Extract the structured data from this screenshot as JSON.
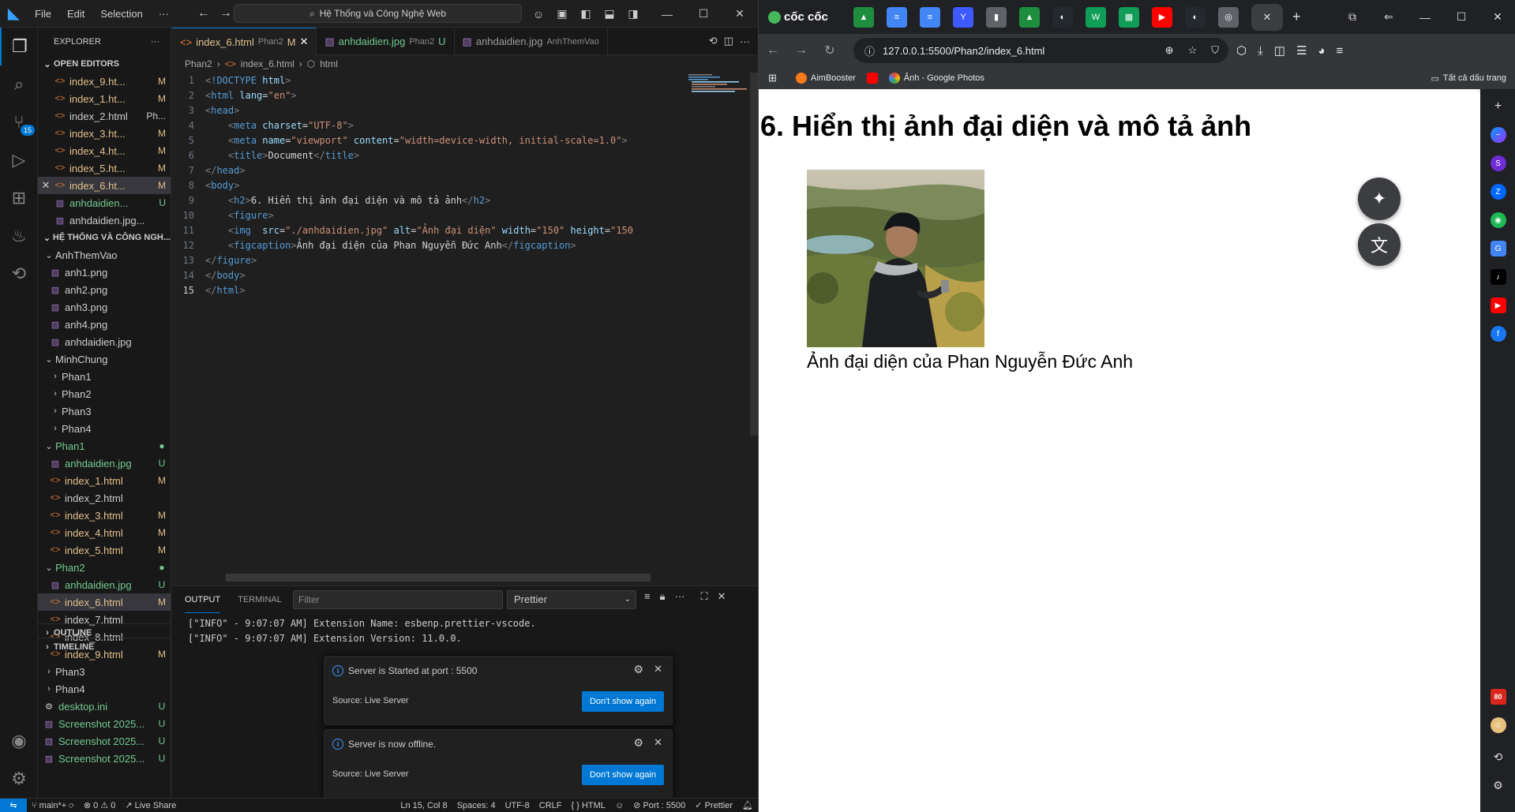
{
  "vscode": {
    "menu": [
      "File",
      "Edit",
      "Selection",
      "···"
    ],
    "command_center": "Hệ Thống và Công Nghệ Web",
    "explorer_title": "EXPLORER",
    "open_editors_title": "OPEN EDITORS",
    "open_editors": [
      {
        "name": "index_9.ht...",
        "status": "M"
      },
      {
        "name": "index_1.ht...",
        "status": "M"
      },
      {
        "name": "index_2.html",
        "status": "Ph..."
      },
      {
        "name": "index_3.ht...",
        "status": "M"
      },
      {
        "name": "index_4.ht...",
        "status": "M"
      },
      {
        "name": "index_5.ht...",
        "status": "M"
      },
      {
        "name": "index_6.ht...",
        "status": "M"
      },
      {
        "name": "anhdaidien...",
        "status": "U"
      },
      {
        "name": "anhdaidien.jpg...",
        "status": ""
      }
    ],
    "workspace_title": "HỆ THỐNG VÀ CÔNG NGH...",
    "tree": [
      {
        "name": "AnhThemVao",
        "kind": "folder-open",
        "depth": 0,
        "status": "",
        "color": "def"
      },
      {
        "name": "anh1.png",
        "kind": "image",
        "depth": 1,
        "status": "",
        "color": "def"
      },
      {
        "name": "anh2.png",
        "kind": "image",
        "depth": 1,
        "status": "",
        "color": "def"
      },
      {
        "name": "anh3.png",
        "kind": "image",
        "depth": 1,
        "status": "",
        "color": "def"
      },
      {
        "name": "anh4.png",
        "kind": "image",
        "depth": 1,
        "status": "",
        "color": "def"
      },
      {
        "name": "anhdaidien.jpg",
        "kind": "image",
        "depth": 1,
        "status": "",
        "color": "def"
      },
      {
        "name": "MinhChung",
        "kind": "folder-open",
        "depth": 0,
        "status": "",
        "color": "def"
      },
      {
        "name": "Phan1",
        "kind": "folder",
        "depth": 1,
        "status": "",
        "color": "def"
      },
      {
        "name": "Phan2",
        "kind": "folder",
        "depth": 1,
        "status": "",
        "color": "def"
      },
      {
        "name": "Phan3",
        "kind": "folder",
        "depth": 1,
        "status": "",
        "color": "def"
      },
      {
        "name": "Phan4",
        "kind": "folder",
        "depth": 1,
        "status": "",
        "color": "def"
      },
      {
        "name": "Phan1",
        "kind": "folder-open",
        "depth": 0,
        "status": "●",
        "color": "unt"
      },
      {
        "name": "anhdaidien.jpg",
        "kind": "image",
        "depth": 1,
        "status": "U",
        "color": "unt"
      },
      {
        "name": "index_1.html",
        "kind": "html",
        "depth": 1,
        "status": "M",
        "color": "mod"
      },
      {
        "name": "index_2.html",
        "kind": "html",
        "depth": 1,
        "status": "",
        "color": "def"
      },
      {
        "name": "index_3.html",
        "kind": "html",
        "depth": 1,
        "status": "M",
        "color": "mod"
      },
      {
        "name": "index_4.html",
        "kind": "html",
        "depth": 1,
        "status": "M",
        "color": "mod"
      },
      {
        "name": "index_5.html",
        "kind": "html",
        "depth": 1,
        "status": "M",
        "color": "mod"
      },
      {
        "name": "Phan2",
        "kind": "folder-open",
        "depth": 0,
        "status": "●",
        "color": "unt"
      },
      {
        "name": "anhdaidien.jpg",
        "kind": "image",
        "depth": 1,
        "status": "U",
        "color": "unt"
      },
      {
        "name": "index_6.html",
        "kind": "html",
        "depth": 1,
        "status": "M",
        "color": "mod"
      },
      {
        "name": "index_7.html",
        "kind": "html",
        "depth": 1,
        "status": "",
        "color": "def"
      },
      {
        "name": "index_8.html",
        "kind": "html",
        "depth": 1,
        "status": "",
        "color": "def"
      },
      {
        "name": "index_9.html",
        "kind": "html",
        "depth": 1,
        "status": "M",
        "color": "mod"
      },
      {
        "name": "Phan3",
        "kind": "folder",
        "depth": 0,
        "status": "",
        "color": "def"
      },
      {
        "name": "Phan4",
        "kind": "folder",
        "depth": 0,
        "status": "",
        "color": "def"
      },
      {
        "name": "desktop.ini",
        "kind": "file",
        "depth": 0,
        "status": "U",
        "color": "unt"
      },
      {
        "name": "Screenshot 2025...",
        "kind": "image",
        "depth": 0,
        "status": "U",
        "color": "unt"
      },
      {
        "name": "Screenshot 2025...",
        "kind": "image",
        "depth": 0,
        "status": "U",
        "color": "unt"
      },
      {
        "name": "Screenshot 2025...",
        "kind": "image",
        "depth": 0,
        "status": "U",
        "color": "unt"
      }
    ],
    "outline_title": "OUTLINE",
    "timeline_title": "TIMELINE",
    "tabs": [
      {
        "name": "index_6.html",
        "sub": "Phan2",
        "status": "M"
      },
      {
        "name": "anhdaidien.jpg",
        "sub": "Phan2",
        "status": "U"
      },
      {
        "name": "anhdaidien.jpg",
        "sub": "AnhThemVao",
        "status": ""
      }
    ],
    "breadcrumb": [
      "Phan2",
      "index_6.html",
      "html"
    ],
    "code_lines": [
      "<!DOCTYPE html>",
      "<html lang=\"en\">",
      "<head>",
      "    <meta charset=\"UTF-8\">",
      "    <meta name=\"viewport\" content=\"width=device-width, initial-scale=1.0\">",
      "    <title>Document</title>",
      "</head>",
      "<body>",
      "    <h2>6. Hiển thị ảnh đại diện và mô tả ảnh</h2>",
      "    <figure>",
      "    <img  src=\"./anhdaidien.jpg\" alt=\"Ảnh đại diện\" width=\"150\" height=\"150",
      "    <figcaption>Ảnh đại diện của Phan Nguyễn Đức Anh</figcaption>",
      "</figure>",
      "</body>",
      "</html>"
    ],
    "current_line": 15,
    "panel_tabs": [
      "OUTPUT",
      "TERMINAL"
    ],
    "panel_filter_placeholder": "Filter",
    "panel_select": "Prettier",
    "output_lines": [
      "[\"INFO\" - 9:07:07 AM] Extension Name: esbenp.prettier-vscode.",
      "[\"INFO\" - 9:07:07 AM] Extension Version: 11.0.0."
    ],
    "notifications": [
      {
        "message": "Server is Started at port : 5500",
        "source": "Source: Live Server",
        "button": "Don't show again"
      },
      {
        "message": "Server is now offline.",
        "source": "Source: Live Server",
        "button": "Don't show again"
      }
    ],
    "status": {
      "branch": "main*+",
      "problems": "⊗ 0 ⚠ 0",
      "liveshare": "Live Share",
      "position": "Ln 15, Col 8",
      "spaces": "Spaces: 4",
      "encoding": "UTF-8",
      "eol": "CRLF",
      "language": "HTML",
      "port": "Port : 5500",
      "formatter": "Prettier"
    },
    "source_control_badge": "15"
  },
  "browser": {
    "brand": "cốc cốc",
    "url": "127.0.0.1:5500/Phan2/index_6.html",
    "bookmarks": [
      "AimBooster",
      "Ảnh - Google Photos"
    ],
    "all_bookmarks": "Tất cả dấu trang",
    "page": {
      "heading": "6. Hiển thị ảnh đại diện và mô tả ảnh",
      "caption": "Ảnh đại diện của Phan Nguyễn Đức Anh"
    },
    "sidebar_badge": "80"
  }
}
